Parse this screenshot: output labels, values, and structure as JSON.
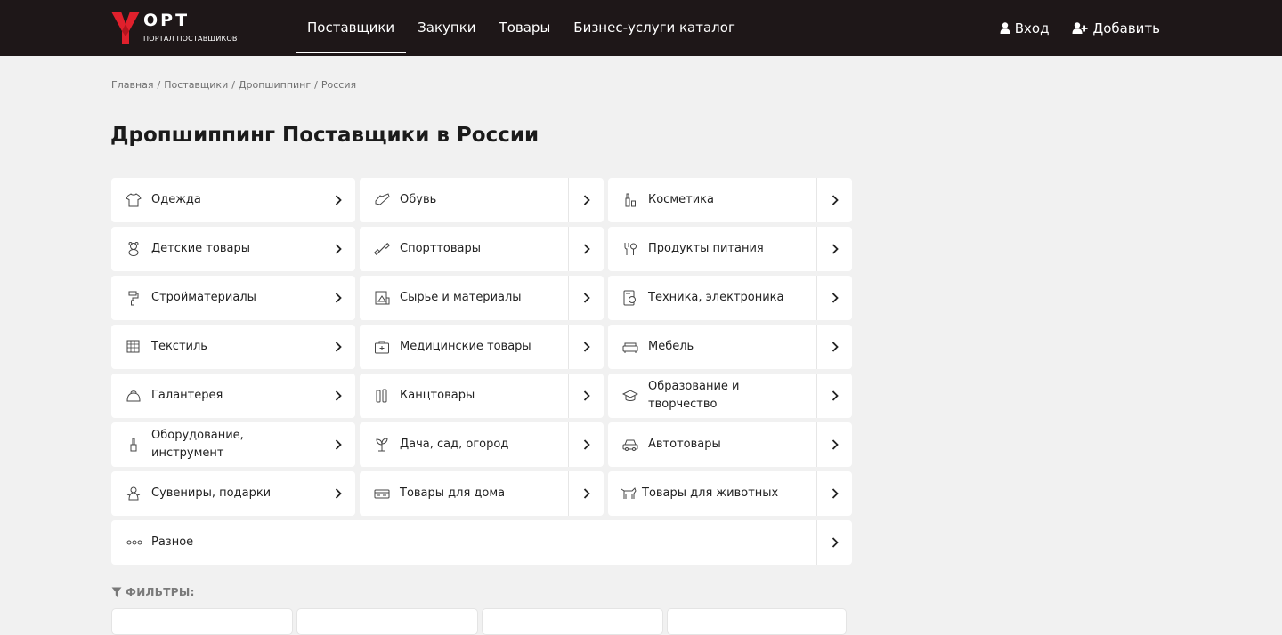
{
  "header": {
    "logo_text": "OPT",
    "logo_subtitle": "ПОРТАЛ ПОСТАВЩИКОВ",
    "brand_color": "#e0202c",
    "nav": [
      {
        "label": "Поставщики",
        "active": true
      },
      {
        "label": "Закупки",
        "active": false
      },
      {
        "label": "Товары",
        "active": false
      },
      {
        "label": "Бизнес-услуги каталог",
        "active": false
      }
    ],
    "login_label": "Вход",
    "add_label": "Добавить"
  },
  "breadcrumb": [
    "Главная",
    "Поставщики",
    "Дропшиппинг",
    "Россия"
  ],
  "page_title": "Дропшиппинг Поставщики в России",
  "categories": [
    {
      "label": "Одежда",
      "icon": "shirt-icon"
    },
    {
      "label": "Обувь",
      "icon": "shoe-icon"
    },
    {
      "label": "Косметика",
      "icon": "cosmetics-icon"
    },
    {
      "label": "Детские товары",
      "icon": "teddy-bear-icon"
    },
    {
      "label": "Спорттовары",
      "icon": "dumbbell-icon"
    },
    {
      "label": "Продукты питания",
      "icon": "food-icon"
    },
    {
      "label": "Стройматериалы",
      "icon": "paint-roller-icon"
    },
    {
      "label": "Сырье и материалы",
      "icon": "raw-materials-icon"
    },
    {
      "label": "Техника, электроника",
      "icon": "appliance-icon"
    },
    {
      "label": "Текстиль",
      "icon": "textile-icon"
    },
    {
      "label": "Медицинские товары",
      "icon": "medkit-icon"
    },
    {
      "label": "Мебель",
      "icon": "sofa-icon"
    },
    {
      "label": "Галантерея",
      "icon": "purse-icon"
    },
    {
      "label": "Канцтовары",
      "icon": "stationery-icon"
    },
    {
      "label": "Образование и творчество",
      "icon": "graduation-cap-icon"
    },
    {
      "label": "Оборудование, инструмент",
      "icon": "tool-icon"
    },
    {
      "label": "Дача, сад, огород",
      "icon": "plant-icon"
    },
    {
      "label": "Автотовары",
      "icon": "car-icon"
    },
    {
      "label": "Сувениры, подарки",
      "icon": "gift-icon"
    },
    {
      "label": "Товары для дома",
      "icon": "home-goods-icon"
    },
    {
      "label": "Товары для животных",
      "icon": "pet-icon"
    },
    {
      "label": "Разное",
      "icon": "dots-icon"
    }
  ],
  "filters_label": "ФИЛЬТРЫ:"
}
